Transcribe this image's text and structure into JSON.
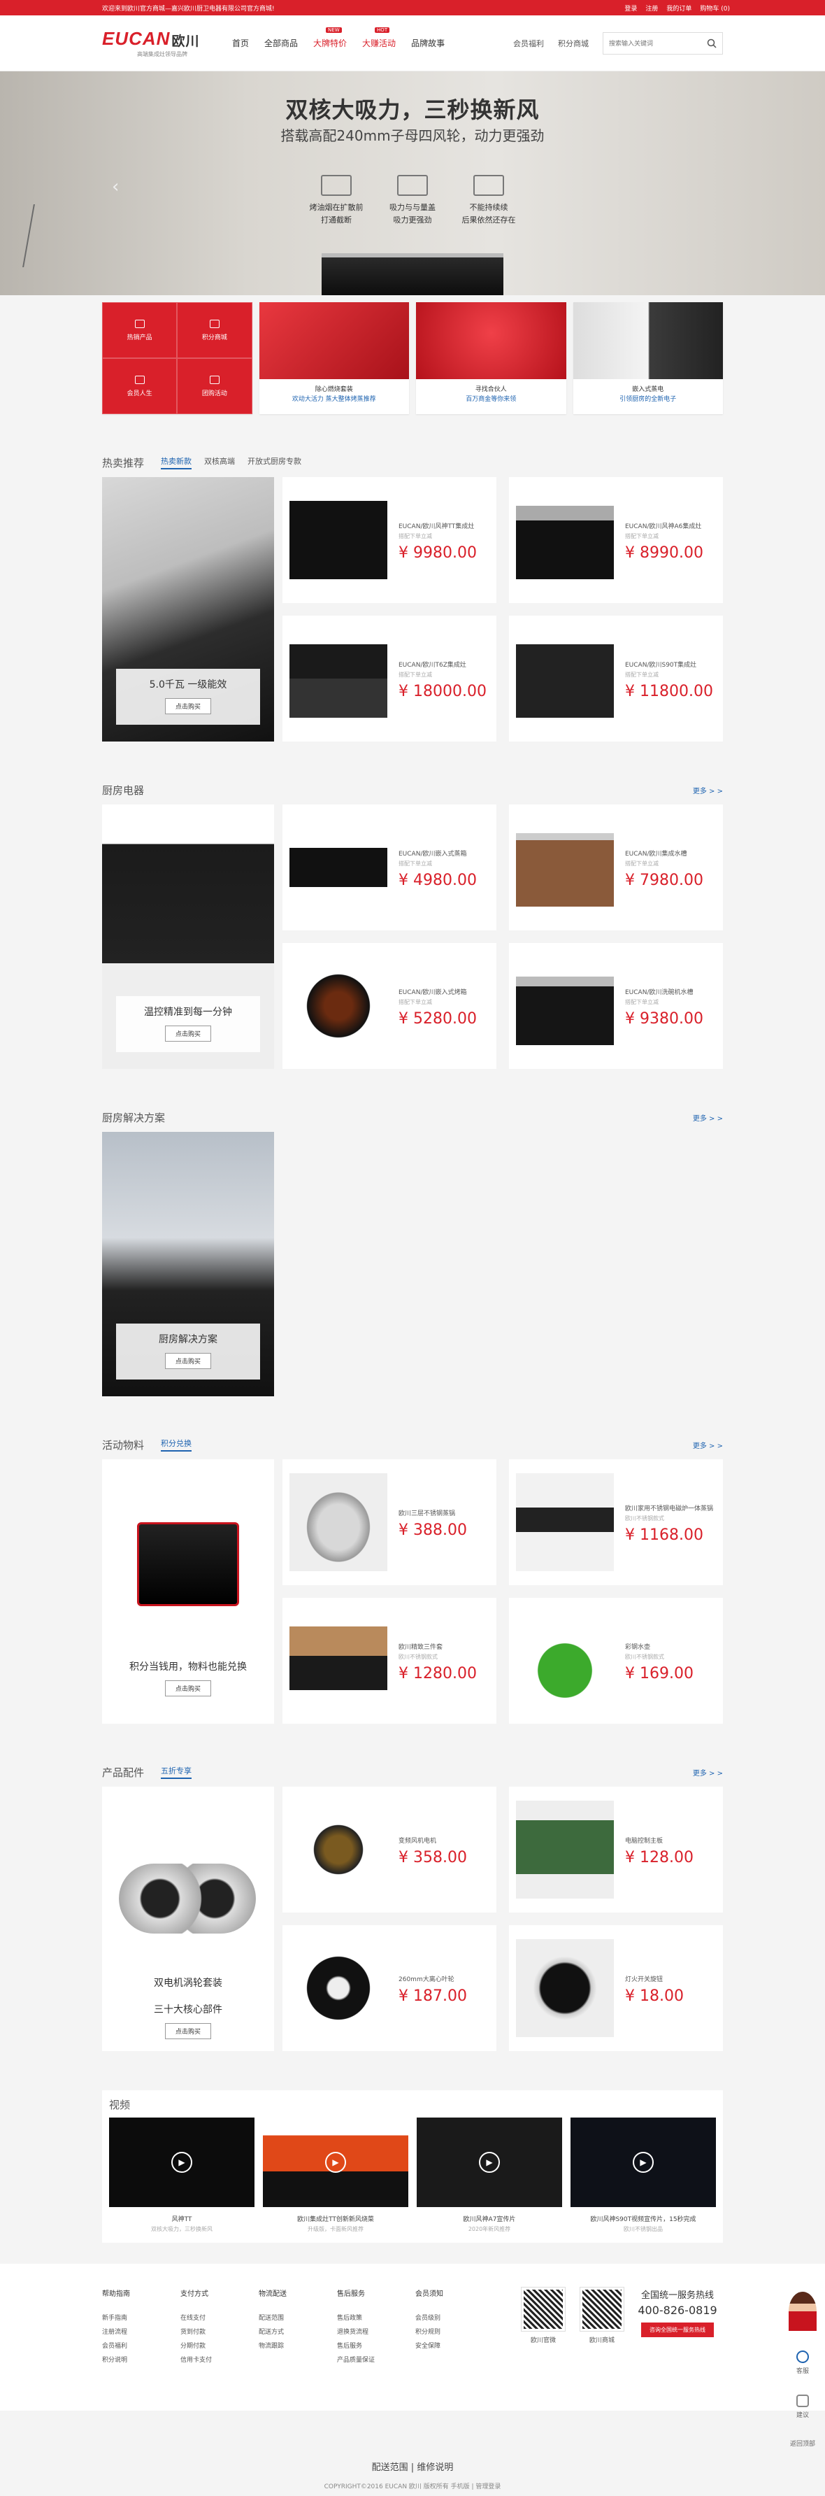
{
  "topbar": {
    "welcome": "欢迎来到欧川官方商城—嘉兴欧川厨卫电器有限公司官方商城!",
    "links": [
      "登录",
      "注册",
      "我的订单",
      "购物车 (0)"
    ]
  },
  "header": {
    "logo": "EUCAN",
    "logo_cn": "欧川",
    "logo_tag": "高端集成灶领导品牌",
    "nav": [
      {
        "label": "首页",
        "hot": false,
        "badge": ""
      },
      {
        "label": "全部商品",
        "hot": false,
        "badge": ""
      },
      {
        "label": "大牌特价",
        "hot": true,
        "badge": "NEW"
      },
      {
        "label": "大赚活动",
        "hot": true,
        "badge": "HOT"
      },
      {
        "label": "品牌故事",
        "hot": false,
        "badge": ""
      }
    ],
    "right_links": [
      "会员福利",
      "积分商城"
    ],
    "search_placeholder": "搜索输入关键词"
  },
  "banner": {
    "title": "双核大吸力，三秒换新风",
    "subtitle": "搭载高配240mm子母四风轮，动力更强劲",
    "features": [
      {
        "line1": "烤油烟在扩散前",
        "line2": "打通截断"
      },
      {
        "line1": "吸力与与量盖",
        "line2": "吸力更强劲"
      },
      {
        "line1": "不能持续续",
        "line2": "后果依然还存在"
      }
    ]
  },
  "promo": {
    "cells": [
      "热销产品",
      "积分商城",
      "会员人生",
      "团购活动"
    ],
    "boxes": [
      {
        "line1": "除心燃烧套装",
        "line2": "欢动大活力 蒸大整体烤蒸推荐"
      },
      {
        "line1": "寻找合伙人",
        "line2": "百万商金等你来领"
      },
      {
        "line1": "嵌入式蒸电",
        "line2": "引领厨房的全新电子"
      }
    ]
  },
  "sections": {
    "hot": {
      "title": "热卖推荐",
      "tabs": [
        "热卖新款",
        "双核高端",
        "开放式厨房专款"
      ],
      "feature_label": "5.0千瓦 一级能效",
      "feature_btn": "点击购买",
      "products": [
        {
          "name": "EUCAN/欧川风神TT集成灶",
          "sub": "搭配下单立减",
          "price": "¥ 9980.00"
        },
        {
          "name": "EUCAN/欧川风神A6集成灶",
          "sub": "搭配下单立减",
          "price": "¥ 8990.00"
        },
        {
          "name": "EUCAN/欧川T6Z集成灶",
          "sub": "搭配下单立减",
          "price": "¥ 18000.00"
        },
        {
          "name": "EUCAN/欧川S90T集成灶",
          "sub": "搭配下单立减",
          "price": "¥ 11800.00"
        }
      ]
    },
    "kitchen": {
      "title": "厨房电器",
      "more": "更多 > >",
      "feature_label": "温控精准到每一分钟",
      "feature_btn": "点击购买",
      "products": [
        {
          "name": "EUCAN/欧川嵌入式蒸箱",
          "sub": "搭配下单立减",
          "price": "¥ 4980.00"
        },
        {
          "name": "EUCAN/欧川集成水槽",
          "sub": "搭配下单立减",
          "price": "¥ 7980.00"
        },
        {
          "name": "EUCAN/欧川嵌入式烤箱",
          "sub": "搭配下单立减",
          "price": "¥ 5280.00"
        },
        {
          "name": "EUCAN/欧川洗碗机水槽",
          "sub": "搭配下单立减",
          "price": "¥ 9380.00"
        }
      ]
    },
    "solution": {
      "title": "厨房解决方案",
      "more": "更多 > >",
      "feature_label": "厨房解决方案",
      "feature_btn": "点击购买"
    },
    "activity": {
      "title": "活动物料",
      "tabs": [
        "积分兑换"
      ],
      "more": "更多 > >",
      "feature_label": "积分当钱用，物料也能兑换",
      "feature_btn": "点击购买",
      "products": [
        {
          "name": "欧川三层不锈钢蒸锅",
          "sub": "",
          "price": "¥ 388.00"
        },
        {
          "name": "欧川家用不锈钢电磁炉一体蒸锅",
          "sub": "欧川不锈钢款式",
          "price": "¥ 1168.00"
        },
        {
          "name": "欧川精致三件套",
          "sub": "欧川不锈钢款式",
          "price": "¥ 1280.00"
        },
        {
          "name": "彩钢水壶",
          "sub": "欧川不锈钢款式",
          "price": "¥ 169.00"
        }
      ]
    },
    "parts": {
      "title": "产品配件",
      "tabs": [
        "五折专享"
      ],
      "more": "更多 > >",
      "feature_label": "双电机涡轮套装",
      "feature_label2": "三十大核心部件",
      "feature_btn": "点击购买",
      "products": [
        {
          "name": "变频风机电机",
          "sub": "",
          "price": "¥ 358.00"
        },
        {
          "name": "电脑控制主板",
          "sub": "",
          "price": "¥ 128.00"
        },
        {
          "name": "260mm大离心叶轮",
          "sub": "",
          "price": "¥ 187.00"
        },
        {
          "name": "灯火开关旋钮",
          "sub": "",
          "price": "¥ 18.00"
        }
      ]
    }
  },
  "videos": {
    "title": "视频",
    "items": [
      {
        "title": "风神TT",
        "sub": "双核大吸力，三秒换新风"
      },
      {
        "title": "欧川集成灶TT创新新风烧菜",
        "sub": "升级版，卡面新风推荐"
      },
      {
        "title": "欧川风神A7宣传片",
        "sub": "2020年新风推荐"
      },
      {
        "title": "欧川风神S90T视频宣传片，15秒完成",
        "sub": "欧川不锈钢出品"
      }
    ]
  },
  "footer": {
    "cols": [
      {
        "head": "帮助指南",
        "items": [
          "新手指南",
          "注册流程",
          "会员福利",
          "积分说明"
        ]
      },
      {
        "head": "支付方式",
        "items": [
          "在线支付",
          "货到付款",
          "分期付款",
          "信用卡支付"
        ]
      },
      {
        "head": "物流配送",
        "items": [
          "配送范围",
          "配送方式",
          "物流跟踪"
        ]
      },
      {
        "head": "售后服务",
        "items": [
          "售后政策",
          "退换货流程",
          "售后服务",
          "产品质量保证"
        ]
      },
      {
        "head": "会员须知",
        "items": [
          "会员级别",
          "积分规则",
          "安全保障"
        ]
      }
    ],
    "qr1": "欧川官微",
    "qr2": "欧川商城",
    "hotline_label": "全国统一服务热线",
    "hotline_number": "400-826-0819",
    "hotline_btn": "咨询全国统一服务热线",
    "copy_main": "配送范围 | 维修说明",
    "copyright": "COPYRIGHT©2016 EUCAN 欧川 版权所有 手机版 | 管理登录"
  },
  "float": {
    "items": [
      "客服",
      "建议",
      "返回顶部"
    ]
  },
  "colors": {
    "brand": "#d9202a",
    "link": "#1e63b0"
  }
}
